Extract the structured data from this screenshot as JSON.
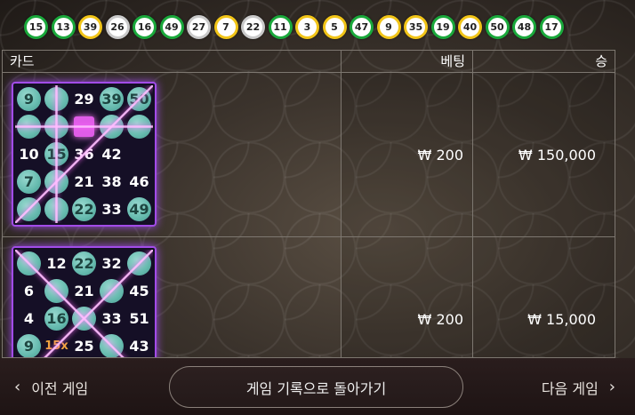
{
  "drawn_balls": [
    {
      "number": "15",
      "color": "green"
    },
    {
      "number": "13",
      "color": "green"
    },
    {
      "number": "39",
      "color": "yellow"
    },
    {
      "number": "26",
      "color": "gray"
    },
    {
      "number": "16",
      "color": "green"
    },
    {
      "number": "49",
      "color": "green"
    },
    {
      "number": "27",
      "color": "gray"
    },
    {
      "number": "7",
      "color": "yellow"
    },
    {
      "number": "22",
      "color": "gray"
    },
    {
      "number": "11",
      "color": "green"
    },
    {
      "number": "3",
      "color": "yellow"
    },
    {
      "number": "5",
      "color": "yellow"
    },
    {
      "number": "47",
      "color": "green"
    },
    {
      "number": "9",
      "color": "yellow"
    },
    {
      "number": "35",
      "color": "yellow"
    },
    {
      "number": "19",
      "color": "green"
    },
    {
      "number": "40",
      "color": "yellow"
    },
    {
      "number": "50",
      "color": "green"
    },
    {
      "number": "48",
      "color": "green"
    },
    {
      "number": "17",
      "color": "green"
    }
  ],
  "table": {
    "headers": {
      "card": "카드",
      "bet": "베팅",
      "win": "승"
    },
    "rows": [
      {
        "bet": "₩ 200",
        "win": "₩ 150,000",
        "card": [
          {
            "n": "9",
            "marked": true
          },
          {
            "n": "",
            "marked": true
          },
          {
            "n": "29",
            "marked": false
          },
          {
            "n": "39",
            "marked": true
          },
          {
            "n": "50",
            "marked": true
          },
          {
            "n": "",
            "marked": true
          },
          {
            "n": "",
            "marked": true
          },
          {
            "n": "",
            "free": true
          },
          {
            "n": "",
            "marked": true
          },
          {
            "n": "",
            "marked": true
          },
          {
            "n": "10",
            "marked": false
          },
          {
            "n": "15",
            "marked": true
          },
          {
            "n": "36",
            "marked": false
          },
          {
            "n": "42",
            "marked": false
          },
          {
            "n": "",
            "hidden": true
          },
          {
            "n": "7",
            "marked": true
          },
          {
            "n": "",
            "marked": true
          },
          {
            "n": "21",
            "marked": false
          },
          {
            "n": "38",
            "marked": false
          },
          {
            "n": "46",
            "marked": false
          },
          {
            "n": "",
            "marked": true
          },
          {
            "n": "",
            "marked": true
          },
          {
            "n": "22",
            "marked": true
          },
          {
            "n": "33",
            "marked": false
          },
          {
            "n": "49",
            "marked": true
          }
        ]
      },
      {
        "bet": "₩ 200",
        "win": "₩ 15,000",
        "card": [
          {
            "n": "",
            "marked": true
          },
          {
            "n": "12",
            "marked": false
          },
          {
            "n": "22",
            "marked": true
          },
          {
            "n": "32",
            "marked": false
          },
          {
            "n": "",
            "marked": true
          },
          {
            "n": "6",
            "marked": false
          },
          {
            "n": "",
            "marked": true
          },
          {
            "n": "21",
            "marked": false
          },
          {
            "n": "",
            "marked": true
          },
          {
            "n": "45",
            "marked": false
          },
          {
            "n": "4",
            "marked": false
          },
          {
            "n": "16",
            "marked": true
          },
          {
            "n": "",
            "marked": true
          },
          {
            "n": "33",
            "marked": false
          },
          {
            "n": "51",
            "marked": false
          },
          {
            "n": "9",
            "marked": true
          },
          {
            "n": "15x",
            "multi": true
          },
          {
            "n": "25",
            "marked": false
          },
          {
            "n": "",
            "marked": true
          },
          {
            "n": "43",
            "marked": false
          },
          {
            "n": "",
            "marked": false
          },
          {
            "n": "",
            "marked": false
          },
          {
            "n": "",
            "marked": false
          },
          {
            "n": "",
            "marked": false
          },
          {
            "n": "",
            "marked": false
          }
        ]
      }
    ]
  },
  "footer": {
    "prev_label": "이전 게임",
    "back_label": "게임 기록으로 돌아가기",
    "next_label": "다음 게임"
  },
  "colors": {
    "ball_green": "#1aa83b",
    "ball_yellow": "#f1c417",
    "ball_gray": "#c9c9c9",
    "card_border": "#a24ce8",
    "marked": "#6ecdbd",
    "multiplier": "#f0a33d"
  }
}
